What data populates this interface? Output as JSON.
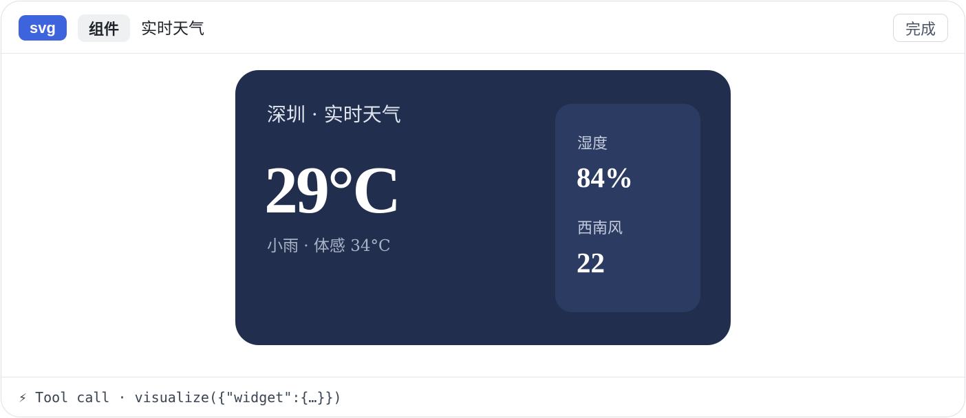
{
  "header": {
    "format_badge": "svg",
    "type_chip": "组件",
    "title": "实时天气",
    "done_label": "完成"
  },
  "weather": {
    "city_heading": "深圳 · 实时天气",
    "temperature": "29°C",
    "condition": "小雨 · 体感 34°C",
    "humidity_label": "湿度",
    "humidity_value": "84%",
    "wind_label": "西南风",
    "wind_value": "22"
  },
  "footer": {
    "tool_call": "⚡ Tool call · visualize({\"widget\":{…}})"
  },
  "colors": {
    "badge_accent": "#3d63dd",
    "card_background": "#212e4d",
    "panel_background": "#2c3b61"
  }
}
